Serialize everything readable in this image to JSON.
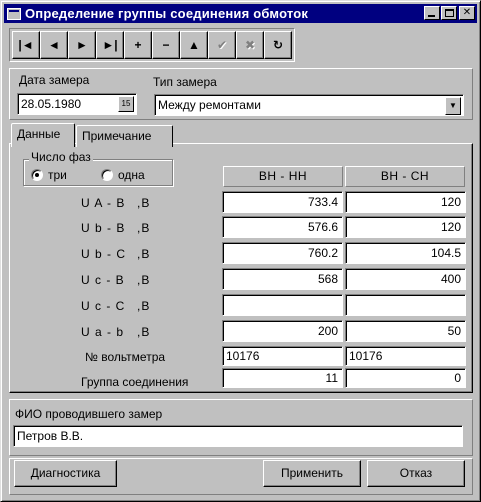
{
  "window": {
    "title": "Определение группы соединения обмоток",
    "buttons": [
      "minimize",
      "maximize",
      "close"
    ]
  },
  "navigator": {
    "buttons": [
      {
        "name": "first-record",
        "glyph": "|◄",
        "enabled": true
      },
      {
        "name": "prior-record",
        "glyph": "◄",
        "enabled": true
      },
      {
        "name": "next-record",
        "glyph": "►",
        "enabled": true
      },
      {
        "name": "last-record",
        "glyph": "►|",
        "enabled": true
      },
      {
        "name": "insert-record",
        "glyph": "+",
        "enabled": true
      },
      {
        "name": "delete-record",
        "glyph": "−",
        "enabled": true
      },
      {
        "name": "edit-record",
        "glyph": "▲",
        "enabled": true
      },
      {
        "name": "post-record",
        "glyph": "✔",
        "enabled": false
      },
      {
        "name": "cancel-record",
        "glyph": "✖",
        "enabled": false
      },
      {
        "name": "refresh-record",
        "glyph": "↻",
        "enabled": true
      }
    ]
  },
  "header": {
    "date_label": "Дата замера",
    "date_value": "28.05.1980",
    "type_label": "Тип замера",
    "type_value": "Между ремонтами"
  },
  "tabs": [
    {
      "label": "Данные",
      "active": true
    },
    {
      "label": "Примечание",
      "active": false
    }
  ],
  "phases": {
    "title": "Число фаз",
    "options": [
      {
        "label": "три",
        "checked": true
      },
      {
        "label": "одна",
        "checked": false
      }
    ]
  },
  "columns": [
    "ВН - НН",
    "ВН - СН"
  ],
  "rows": [
    {
      "label": "U A - B",
      "unit": ",В",
      "values": [
        "733.4",
        "120"
      ]
    },
    {
      "label": "U b - B",
      "unit": ",В",
      "values": [
        "576.6",
        "120"
      ]
    },
    {
      "label": "U b - C",
      "unit": ",В",
      "values": [
        "760.2",
        "104.5"
      ]
    },
    {
      "label": "U c - B",
      "unit": ",В",
      "values": [
        "568",
        "400"
      ]
    },
    {
      "label": "U c - C",
      "unit": ",В",
      "values": [
        "",
        ""
      ]
    },
    {
      "label": "U a - b",
      "unit": ",В",
      "values": [
        "200",
        "50"
      ]
    }
  ],
  "voltmeter": {
    "label": "№ вольтметра",
    "values": [
      "10176",
      "10176"
    ]
  },
  "group": {
    "label": "Группа соединения",
    "values": [
      "11",
      "0"
    ]
  },
  "operator": {
    "label": "ФИО проводившего замер",
    "value": "Петров В.В."
  },
  "buttons": {
    "diagnostics": "Диагностика",
    "apply": "Применить",
    "cancel": "Отказ"
  },
  "colors": {
    "titlebar": "#000080",
    "face": "#c0c0c0"
  }
}
